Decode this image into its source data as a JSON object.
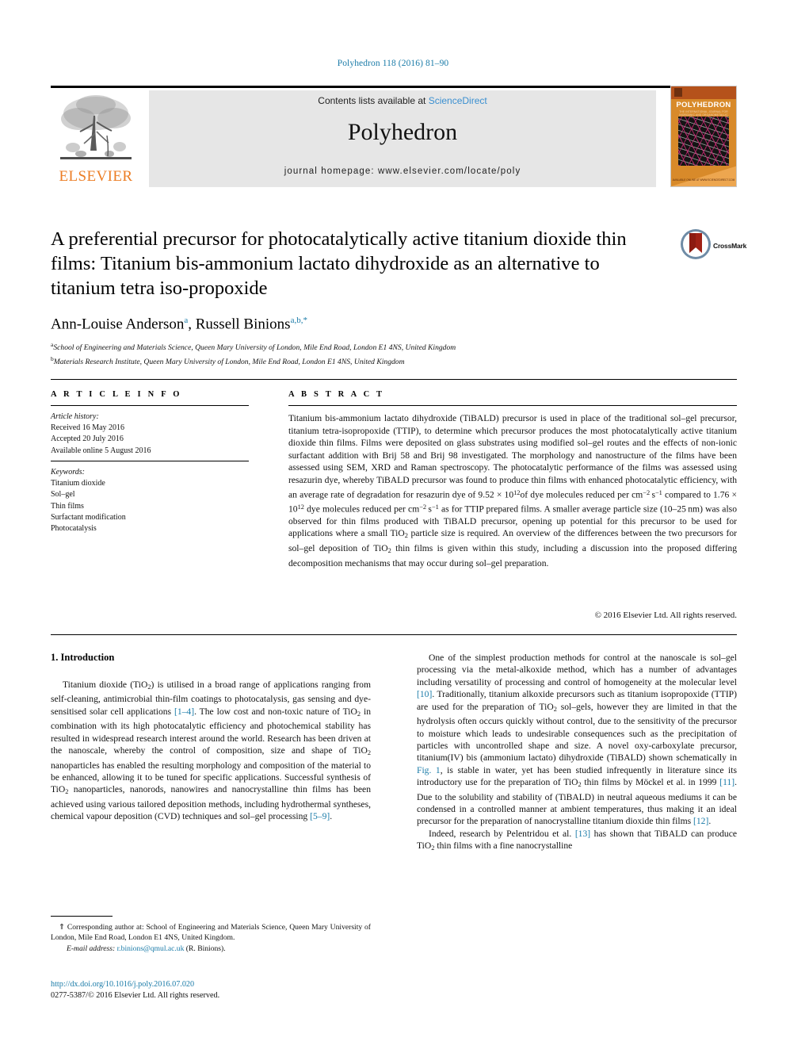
{
  "running_head": "Polyhedron 118 (2016) 81–90",
  "banner": {
    "publisher_name": "ELSEVIER",
    "contents_prefix": "Contents lists available at ",
    "contents_link": "ScienceDirect",
    "journal_name": "Polyhedron",
    "homepage_label": "journal homepage: www.elsevier.com/locate/poly",
    "cover": {
      "title": "POLYHEDRON",
      "subtitle": "THE INTERNATIONAL JOURNAL FOR INORGANIC AND ORGANOMETALLIC CHEMISTRY",
      "footer": "AVAILABLE ONLINE AT WWW.SCIENCEDIRECT.COM"
    }
  },
  "article": {
    "title": "A preferential precursor for photocatalytically active titanium dioxide thin films: Titanium bis-ammonium lactato dihydroxide as an alternative to titanium tetra iso-propoxide",
    "crossmark_label": "CrossMark",
    "authors": [
      {
        "name": "Ann-Louise Anderson",
        "marks": "a"
      },
      {
        "name": "Russell Binions",
        "marks": "a,b,*"
      }
    ],
    "affiliations": [
      {
        "mark": "a",
        "text": "School of Engineering and Materials Science, Queen Mary University of London, Mile End Road, London E1 4NS, United Kingdom"
      },
      {
        "mark": "b",
        "text": "Materials Research Institute, Queen Mary University of London, Mile End Road, London E1 4NS, United Kingdom"
      }
    ]
  },
  "info": {
    "heading": "A R T I C L E   I N F O",
    "history_label": "Article history:",
    "history": [
      "Received 16 May 2016",
      "Accepted 20 July 2016",
      "Available online 5 August 2016"
    ],
    "keywords_label": "Keywords:",
    "keywords": [
      "Titanium dioxide",
      "Sol–gel",
      "Thin films",
      "Surfactant modification",
      "Photocatalysis"
    ]
  },
  "abstract": {
    "heading": "A B S T R A C T",
    "copyright": "© 2016 Elsevier Ltd. All rights reserved."
  },
  "body": {
    "section_title": "1. Introduction"
  },
  "footnote": {
    "corresponding": "⇑ Corresponding author at: School of Engineering and Materials Science, Queen Mary University of London, Mile End Road, London E1 4NS, United Kingdom.",
    "email_label": "E-mail address:",
    "email": "r.binions@qmul.ac.uk",
    "email_owner": "(R. Binions).",
    "doi": "http://dx.doi.org/10.1016/j.poly.2016.07.020",
    "issn_line": "0277-5387/© 2016 Elsevier Ltd. All rights reserved."
  },
  "colors": {
    "link": "#1a7ba8",
    "sciencedirect": "#3a8fd0",
    "elsevier_orange": "#ec7d24",
    "banner_grey": "#e6e6e6"
  }
}
